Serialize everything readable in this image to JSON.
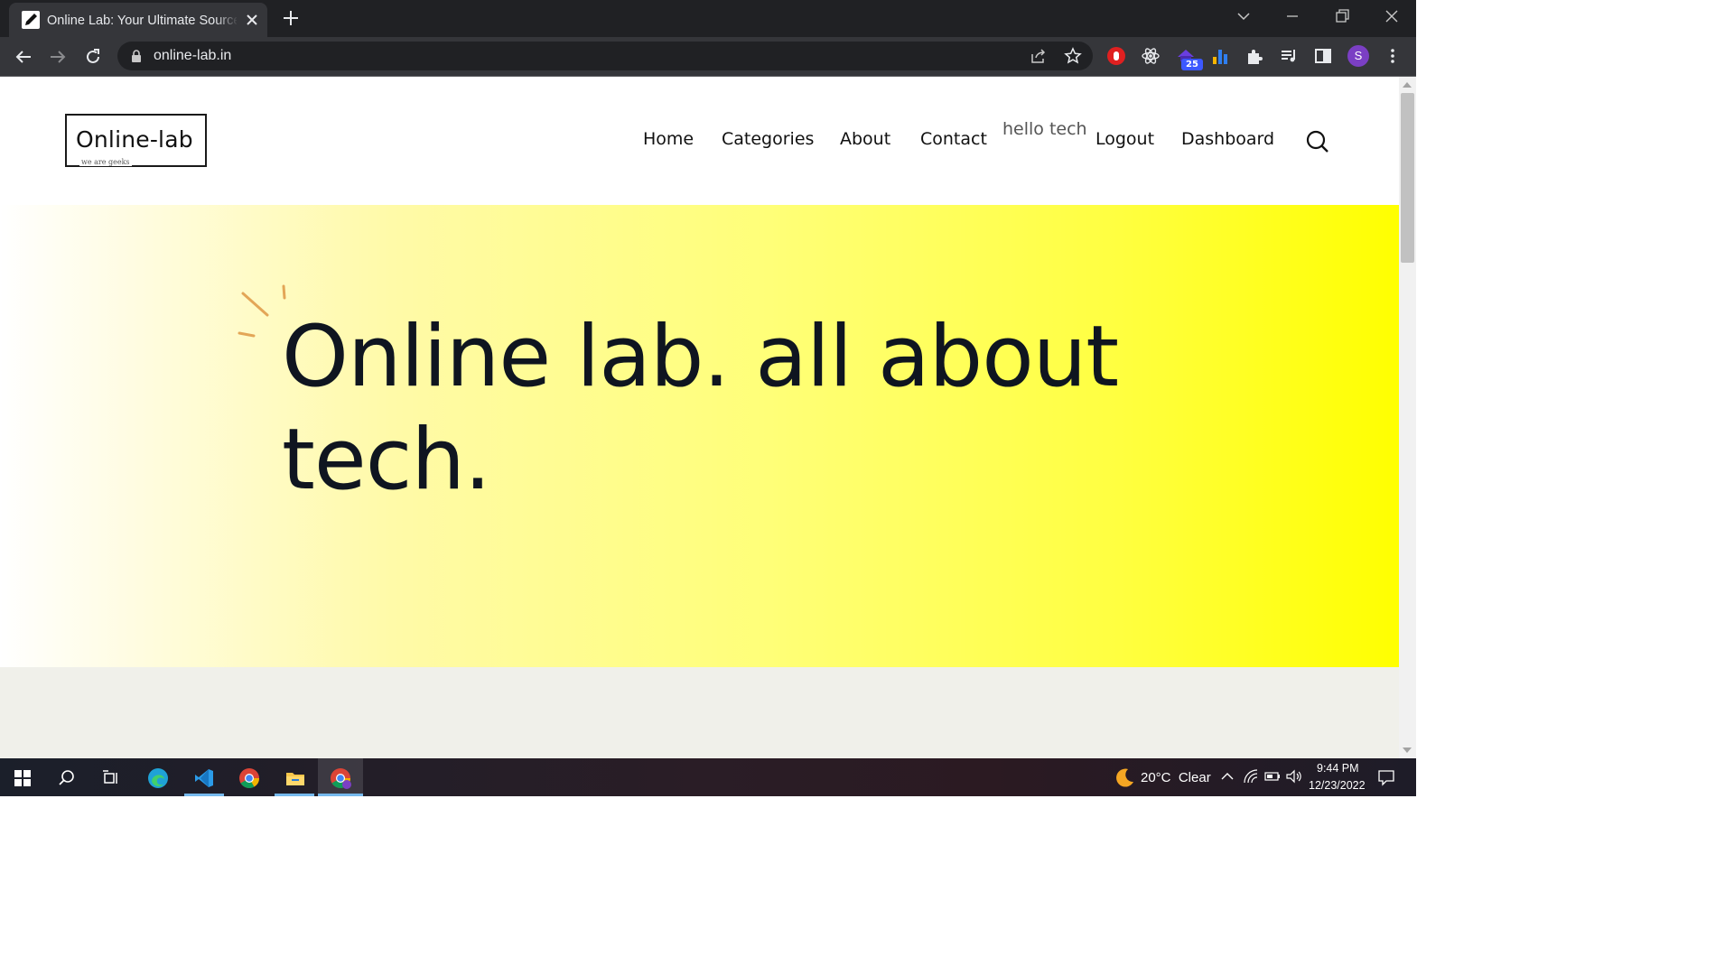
{
  "browser": {
    "tab_title": "Online Lab: Your Ultimate Source",
    "url": "online-lab.in",
    "extension_badge": "25",
    "profile_initial": "S"
  },
  "site": {
    "logo_text": "Online-lab",
    "logo_tagline": "we are geeks",
    "nav": [
      "Home",
      "Categories",
      "About",
      "Contact"
    ],
    "hello_text": "hello tech",
    "nav_right": [
      "Logout",
      "Dashboard"
    ],
    "hero_title": "Online lab. all about tech."
  },
  "taskbar": {
    "weather": "20°C  Clear",
    "time": "9:44 PM",
    "date": "12/23/2022"
  },
  "colors": {
    "hero_start": "#ffffff",
    "hero_end": "#ffff00",
    "hero_text": "#0f1520",
    "deco": "#e3a657"
  }
}
